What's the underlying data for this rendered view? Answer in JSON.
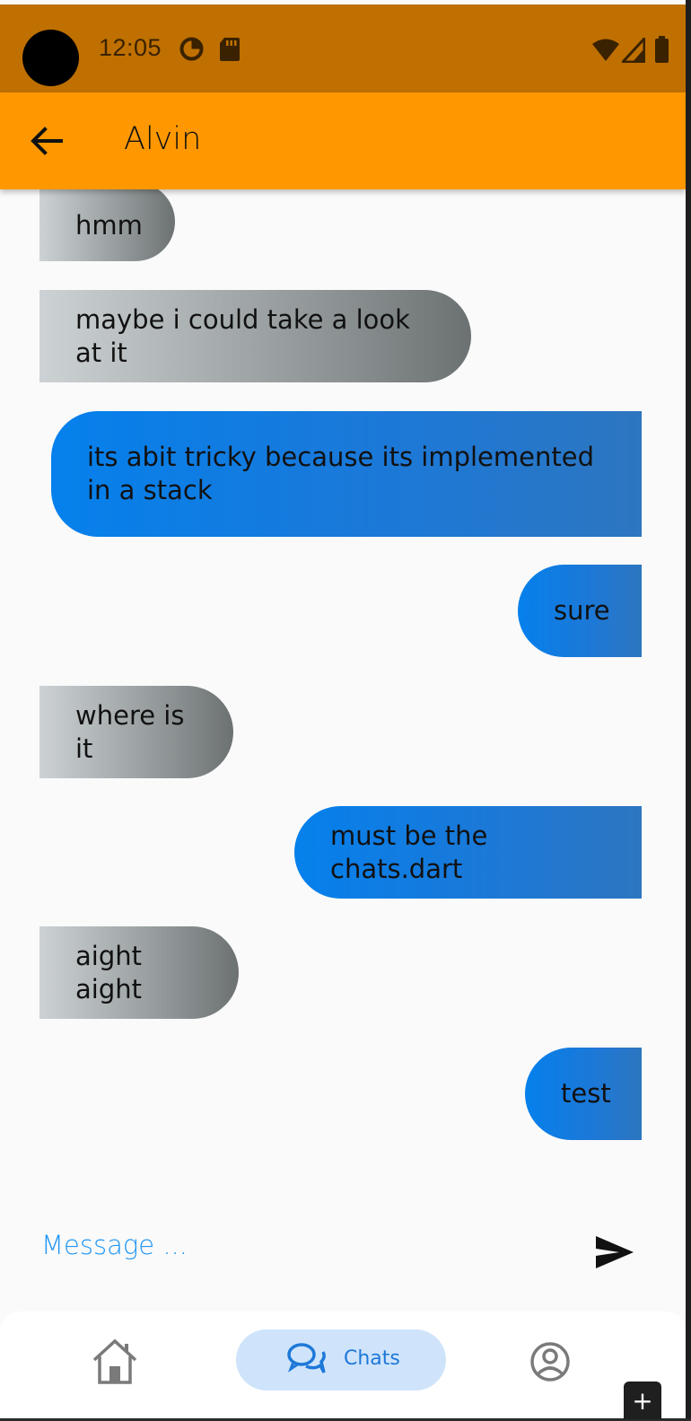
{
  "status_bar": {
    "time": "12:05",
    "icons": [
      "camera-cutout",
      "data-saver-icon",
      "sd-card-icon",
      "wifi-icon",
      "signal-icon",
      "battery-icon"
    ]
  },
  "app_bar": {
    "back_icon": "arrow-left-icon",
    "title": "Alvin",
    "color": "#ff9800"
  },
  "messages": [
    {
      "side": "incoming",
      "text": "hmm"
    },
    {
      "side": "incoming",
      "text": "maybe i could take a look at it"
    },
    {
      "side": "outgoing",
      "text": "its abit tricky because its implemented in a stack"
    },
    {
      "side": "outgoing",
      "text": "sure"
    },
    {
      "side": "incoming",
      "text": "where is it"
    },
    {
      "side": "outgoing",
      "text": "must be the chats.dart"
    },
    {
      "side": "incoming",
      "text": "aight aight"
    },
    {
      "side": "outgoing",
      "text": "test"
    }
  ],
  "composer": {
    "placeholder": "Message ...",
    "value": "",
    "send_icon": "send-icon"
  },
  "bottom_nav": {
    "items": [
      {
        "icon": "home-icon",
        "label": "",
        "active": false
      },
      {
        "icon": "chat-bubbles-icon",
        "label": "Chats",
        "active": true
      },
      {
        "icon": "account-circle-icon",
        "label": "",
        "active": false
      }
    ]
  },
  "floating_button": {
    "label": "+"
  },
  "colors": {
    "status_bar": "#bf7000",
    "incoming_bubble": [
      "#cdd2d5",
      "#6c7172"
    ],
    "outgoing_bubble": [
      "#0580ec",
      "#2d76c0"
    ],
    "accent": "#2196f3"
  }
}
